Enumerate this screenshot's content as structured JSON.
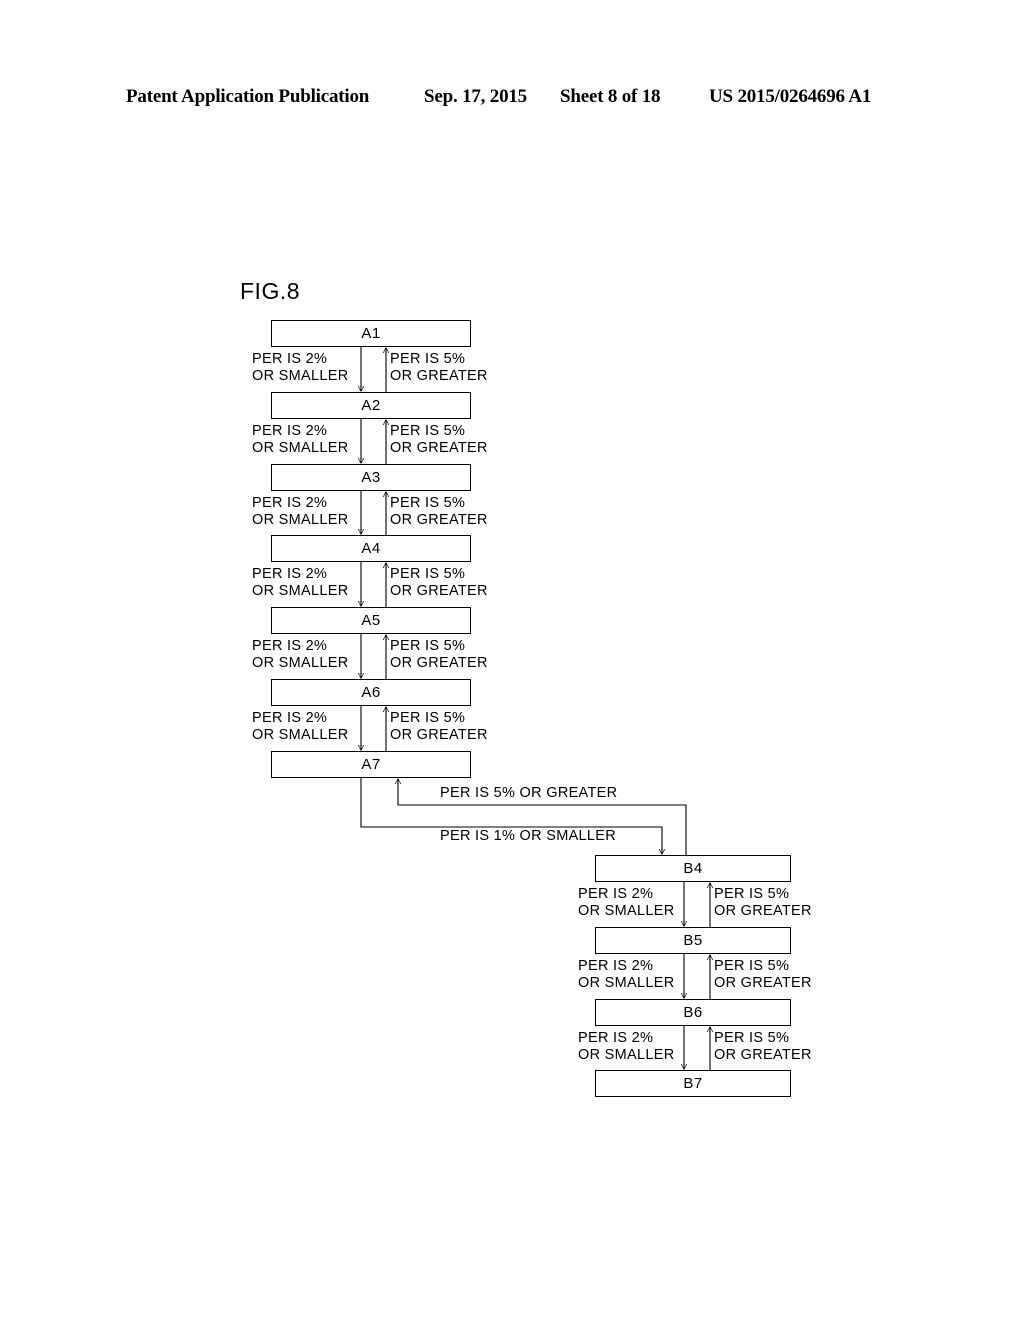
{
  "header": {
    "publication": "Patent Application Publication",
    "date": "Sep. 17, 2015",
    "sheet": "Sheet 8 of 18",
    "number": "US 2015/0264696 A1"
  },
  "figure": {
    "label": "FIG.8",
    "down_label_line1": "PER IS 2%",
    "down_label_line2": "OR SMALLER",
    "up_label_line1": "PER IS 5%",
    "up_label_line2": "OR GREATER",
    "cross_up_label": "PER IS 5% OR GREATER",
    "cross_down_label": "PER IS 1% OR SMALLER",
    "chain_a": [
      {
        "id": "A1",
        "label": "A1"
      },
      {
        "id": "A2",
        "label": "A2"
      },
      {
        "id": "A3",
        "label": "A3"
      },
      {
        "id": "A4",
        "label": "A4"
      },
      {
        "id": "A5",
        "label": "A5"
      },
      {
        "id": "A6",
        "label": "A6"
      },
      {
        "id": "A7",
        "label": "A7"
      }
    ],
    "chain_b": [
      {
        "id": "B4",
        "label": "B4"
      },
      {
        "id": "B5",
        "label": "B5"
      },
      {
        "id": "B6",
        "label": "B6"
      },
      {
        "id": "B7",
        "label": "B7"
      }
    ],
    "colors": {
      "stroke": "#000000",
      "background": "#ffffff"
    }
  }
}
